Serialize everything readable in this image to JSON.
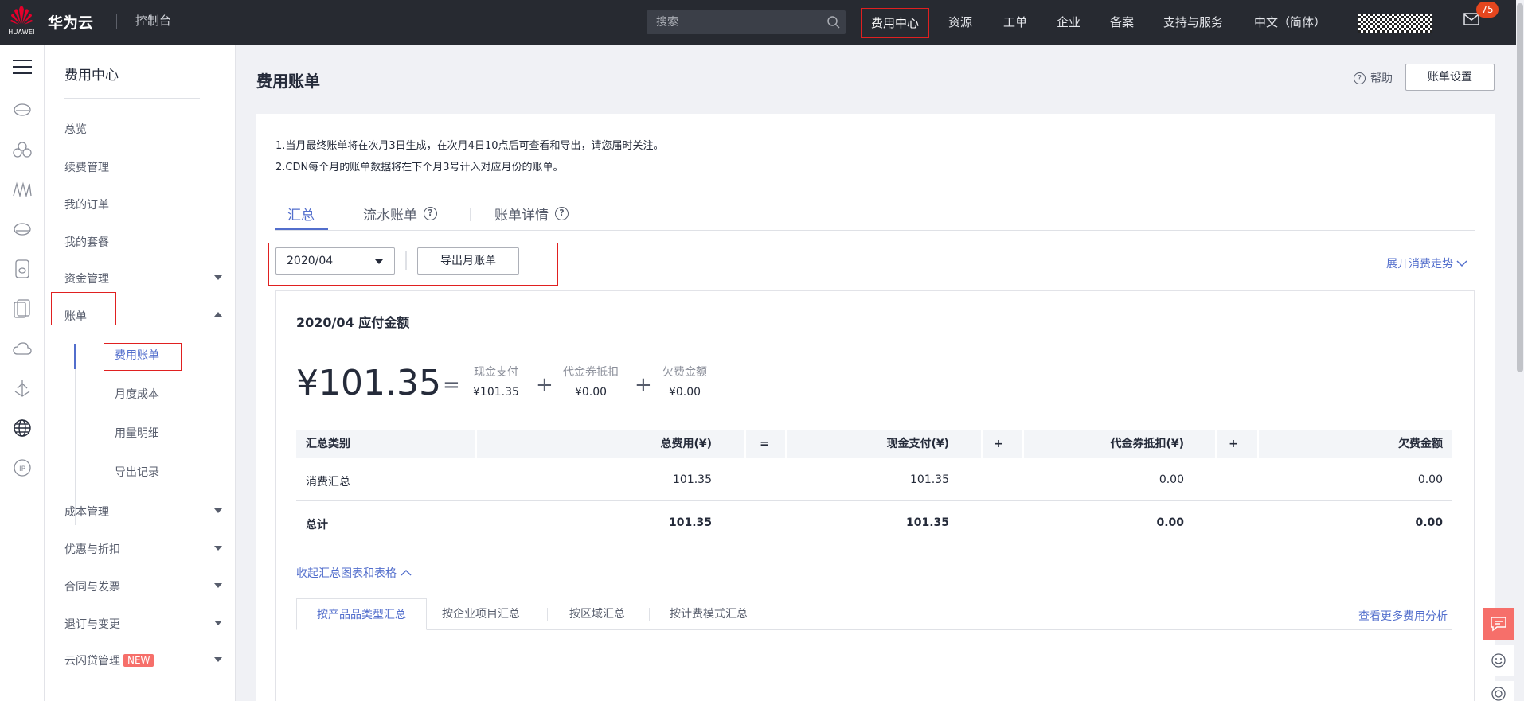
{
  "topbar": {
    "logo_text": "HUAWEI",
    "brand": "华为云",
    "console": "控制台",
    "search_placeholder": "搜索",
    "nav": [
      "费用中心",
      "资源",
      "工单",
      "企业",
      "备案",
      "支持与服务",
      "中文（简体）"
    ],
    "mail_count": "75"
  },
  "rail": {
    "icons": [
      "menu-icon",
      "cloud-server-icon",
      "cluster-icon",
      "network-icon",
      "storage-icon",
      "database-icon",
      "security-icon",
      "cloud-icon",
      "anchor-icon",
      "globe-icon",
      "ip-icon"
    ]
  },
  "sidebar": {
    "title": "费用中心",
    "items": [
      {
        "label": "总览"
      },
      {
        "label": "续费管理"
      },
      {
        "label": "我的订单"
      },
      {
        "label": "我的套餐"
      },
      {
        "label": "资金管理"
      },
      {
        "label": "账单"
      },
      {
        "label": "成本管理"
      },
      {
        "label": "优惠与折扣"
      },
      {
        "label": "合同与发票"
      },
      {
        "label": "退订与变更"
      },
      {
        "label": "云闪贷管理",
        "tag": "NEW"
      }
    ],
    "bill_subitems": [
      "费用账单",
      "月度成本",
      "用量明细",
      "导出记录"
    ]
  },
  "page": {
    "title": "费用账单",
    "help": "帮助",
    "bill_settings": "账单设置",
    "notices": [
      "1.当月最终账单将在次月3日生成，在次月4日10点后可查看和导出，请您届时关注。",
      "2.CDN每个月的账单数据将在下个月3号计入对应月份的账单。"
    ],
    "tabs": [
      "汇总",
      "流水账单",
      "账单详情"
    ],
    "month": "2020/04",
    "export": "导出月账单",
    "expand_trend": "展开消费走势"
  },
  "summary": {
    "title": "2020/04 应付金额",
    "amount": "¥101.35",
    "eq": "=",
    "plus": "+",
    "cash_label": "现金支付",
    "cash_value": "¥101.35",
    "coupon_label": "代金券抵扣",
    "coupon_value": "¥0.00",
    "debt_label": "欠费金额",
    "debt_value": "¥0.00"
  },
  "table": {
    "headers": [
      "汇总类别",
      "总费用(¥)",
      "=",
      "现金支付(¥)",
      "+",
      "代金券抵扣(¥)",
      "+",
      "欠费金额"
    ],
    "rows": [
      [
        "消费汇总",
        "101.35",
        "101.35",
        "0.00",
        "0.00"
      ],
      [
        "总计",
        "101.35",
        "101.35",
        "0.00",
        "0.00"
      ]
    ]
  },
  "charts_section": {
    "collapse": "收起汇总图表和表格",
    "subtabs": [
      "按产品品类型汇总",
      "按企业项目汇总",
      "按区域汇总",
      "按计费模式汇总"
    ],
    "more": "查看更多费用分析"
  },
  "colors": {
    "topbar": "#272a31",
    "accent": "#526ecc",
    "highlight_box": "#e02020",
    "badge": "#e6461e",
    "chat_button": "#f66f6a"
  }
}
